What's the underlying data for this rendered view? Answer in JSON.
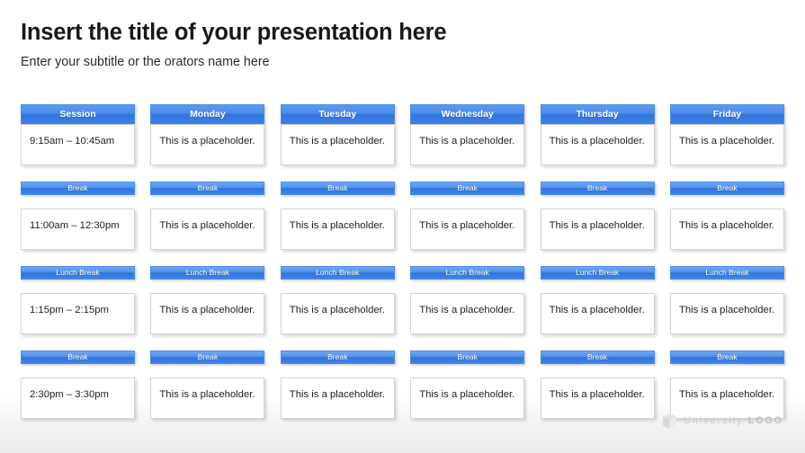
{
  "slide": {
    "title": "Insert the title of your presentation here",
    "subtitle": "Enter your subtitle or the orators name here",
    "background_color": "#ffffff",
    "accent_color": "#2f74dc",
    "header_text_color": "#ffffff",
    "title_color": "#181818"
  },
  "timetable": {
    "columns": [
      {
        "id": "session",
        "label": "Session"
      },
      {
        "id": "monday",
        "label": "Monday"
      },
      {
        "id": "tuesday",
        "label": "Tuesday"
      },
      {
        "id": "wednesday",
        "label": "Wednesday"
      },
      {
        "id": "thursday",
        "label": "Thursday"
      },
      {
        "id": "friday",
        "label": "Friday"
      }
    ],
    "placeholder": "This is a placeholder.",
    "rows": [
      {
        "type": "session",
        "time": "9:15am – 10:45am",
        "cells": [
          "This is a placeholder.",
          "This is a placeholder.",
          "This is a placeholder.",
          "This is a placeholder.",
          "This is a placeholder."
        ]
      },
      {
        "type": "break",
        "label": "Break",
        "labels": [
          "Break",
          "Break",
          "Break",
          "Break",
          "Break",
          "Break"
        ]
      },
      {
        "type": "session",
        "time": "11:00am – 12:30pm",
        "cells": [
          "This is a placeholder.",
          "This is a placeholder.",
          "This is a placeholder.",
          "This is a placeholder.",
          "This is a placeholder."
        ]
      },
      {
        "type": "break",
        "label": "Lunch Break",
        "labels": [
          "Lunch Break",
          "Lunch Break",
          "Lunch Break",
          "Lunch Break",
          "Lunch Break",
          "Lunch Break"
        ]
      },
      {
        "type": "session",
        "time": "1:15pm – 2:15pm",
        "cells": [
          "This is a placeholder.",
          "This is a placeholder.",
          "This is a placeholder.",
          "This is a placeholder.",
          "This is a placeholder."
        ]
      },
      {
        "type": "break",
        "label": "Break",
        "labels": [
          "Break",
          "Break",
          "Break",
          "Break",
          "Break",
          "Break"
        ]
      },
      {
        "type": "session",
        "time": "2:30pm – 3:30pm",
        "cells": [
          "This is a placeholder.",
          "This is a placeholder.",
          "This is a placeholder.",
          "This is a placeholder.",
          "This is a placeholder."
        ]
      }
    ]
  },
  "logo": {
    "icon": "cube-icon",
    "word_light": "University ",
    "word_bold": "LOGO",
    "color": "#c9c9c9"
  }
}
